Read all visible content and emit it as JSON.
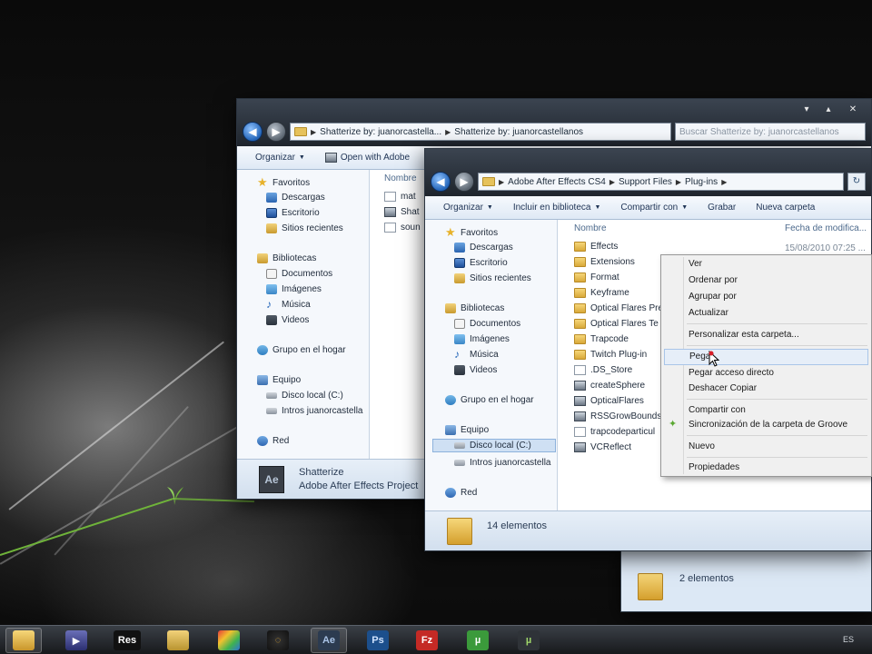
{
  "back_window": {
    "address": [
      "Shatterize by: juanorcastella...",
      "Shatterize by: juanorcastellanos"
    ],
    "search_placeholder": "Buscar Shatterize by: juanorcastellanos",
    "toolbar": [
      "Organizar",
      "Open with Adobe"
    ],
    "nav": [
      "Favoritos",
      "Descargas",
      "Escritorio",
      "Sitios recientes",
      "Bibliotecas",
      "Documentos",
      "Imágenes",
      "Música",
      "Videos",
      "Grupo en el hogar",
      "Equipo",
      "Disco local (C:)",
      "Intros juanorcastella",
      "Red"
    ],
    "column": "Nombre",
    "files": [
      "mat",
      "Shat",
      "soun"
    ],
    "details_name": "Shatterize",
    "details_type": "Adobe After Effects Project"
  },
  "front_window": {
    "address": [
      "Adobe After Effects CS4",
      "Support Files",
      "Plug-ins"
    ],
    "toolbar": [
      "Organizar",
      "Incluir en biblioteca",
      "Compartir con",
      "Grabar",
      "Nueva carpeta"
    ],
    "nav": [
      "Favoritos",
      "Descargas",
      "Escritorio",
      "Sitios recientes",
      "Bibliotecas",
      "Documentos",
      "Imágenes",
      "Música",
      "Videos",
      "Grupo en el hogar",
      "Equipo",
      "Disco local (C:)",
      "Intros juanorcastella",
      "Red"
    ],
    "col_name": "Nombre",
    "col_date": "Fecha de modifica...",
    "first_date": "15/08/2010 07:25 ...",
    "files": [
      {
        "name": "Effects",
        "kind": "folder"
      },
      {
        "name": "Extensions",
        "kind": "folder"
      },
      {
        "name": "Format",
        "kind": "folder"
      },
      {
        "name": "Keyframe",
        "kind": "folder"
      },
      {
        "name": "Optical Flares Pre",
        "kind": "folder"
      },
      {
        "name": "Optical Flares Te",
        "kind": "folder"
      },
      {
        "name": "Trapcode",
        "kind": "folder"
      },
      {
        "name": "Twitch Plug-in",
        "kind": "folder"
      },
      {
        "name": ".DS_Store",
        "kind": "file"
      },
      {
        "name": "createSphere",
        "kind": "exe"
      },
      {
        "name": "OpticalFlares",
        "kind": "exe"
      },
      {
        "name": "RSSGrowBounds",
        "kind": "exe"
      },
      {
        "name": "trapcodeparticul",
        "kind": "file"
      },
      {
        "name": "VCReflect",
        "kind": "exe"
      }
    ],
    "status": "14 elementos"
  },
  "third_window": {
    "status": "2 elementos"
  },
  "context_menu": {
    "items": [
      "Ver",
      "Ordenar por",
      "Agrupar por",
      "Actualizar",
      "Personalizar esta carpeta...",
      "Pegar",
      "Pegar acceso directo",
      "Deshacer Copiar",
      "Compartir con",
      "Sincronización de la carpeta de Groove",
      "Nuevo",
      "Propiedades"
    ]
  },
  "taskbar": {
    "apps": [
      "explorer",
      "media",
      "Res",
      "folder",
      "colors",
      "swirl",
      "Ae",
      "Ps",
      "Fz",
      "µ",
      "utorrent"
    ],
    "ae_label": "Ae",
    "ps_label": "Ps",
    "res_label": "Res",
    "fz_label": "Fz",
    "ut_label": "µ",
    "lang": "ES"
  },
  "colors": {
    "accent": "#2465b8",
    "folder": "#e6c25b",
    "highlight": "#e6eef8"
  }
}
